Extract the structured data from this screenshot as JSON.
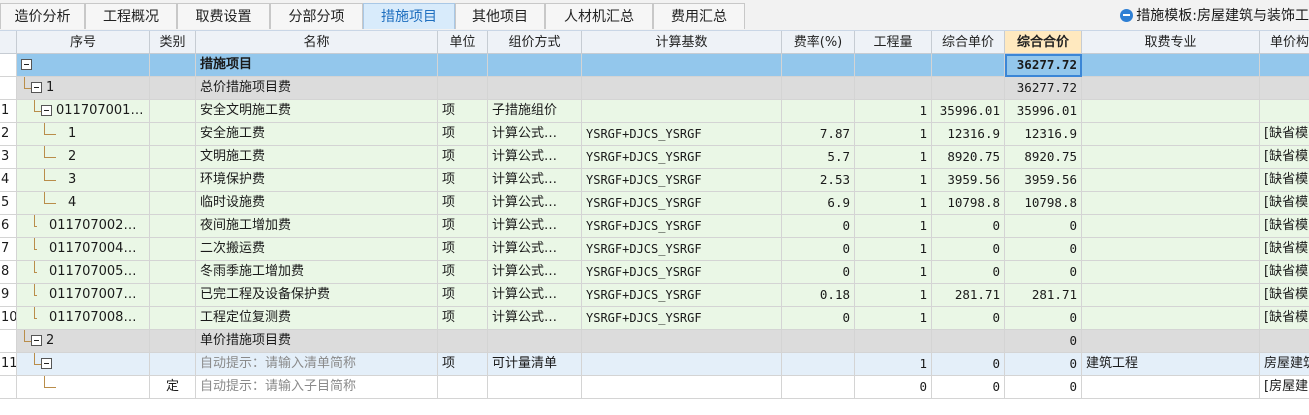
{
  "tabs": [
    {
      "label": "造价分析",
      "name": "tab-cost-analysis"
    },
    {
      "label": "工程概况",
      "name": "tab-project-overview"
    },
    {
      "label": "取费设置",
      "name": "tab-fee-settings"
    },
    {
      "label": "分部分项",
      "name": "tab-sub-items"
    },
    {
      "label": "措施项目",
      "name": "tab-measure-items",
      "active": true
    },
    {
      "label": "其他项目",
      "name": "tab-other-items"
    },
    {
      "label": "人材机汇总",
      "name": "tab-resource-summary"
    },
    {
      "label": "费用汇总",
      "name": "tab-fee-summary"
    }
  ],
  "template_label": "措施模板:房屋建筑与装饰工",
  "columns": [
    "",
    "序号",
    "类别",
    "名称",
    "单位",
    "组价方式",
    "计算基数",
    "费率(%)",
    "工程量",
    "综合单价",
    "综合合价",
    "取费专业",
    "单价构"
  ],
  "rows": [
    {
      "rownum": "",
      "level": 0,
      "seq": "",
      "type": "",
      "name": "措施项目",
      "unit": "",
      "method": "",
      "base": "",
      "rate": "",
      "qty": "",
      "price": "",
      "total": "36277.72",
      "fee": "",
      "unitc": "",
      "bg": "head",
      "bold": true,
      "toggle": true
    },
    {
      "rownum": "",
      "level": 1,
      "seq": "1",
      "type": "",
      "name": "总价措施项目费",
      "unit": "",
      "method": "",
      "base": "",
      "rate": "",
      "qty": "",
      "price": "",
      "total": "36277.72",
      "fee": "",
      "unitc": "",
      "bg": "grey",
      "toggle": true
    },
    {
      "rownum": "1",
      "level": 2,
      "seq": "011707001…",
      "type": "",
      "name": "安全文明施工费",
      "unit": "项",
      "method": "子措施组价",
      "base": "",
      "rate": "",
      "qty": "1",
      "price": "35996.01",
      "total": "35996.01",
      "fee": "",
      "unitc": "",
      "bg": "green",
      "toggle": true
    },
    {
      "rownum": "2",
      "level": 3,
      "seq": "1",
      "type": "",
      "name": "安全施工费",
      "unit": "项",
      "method": "计算公式…",
      "base": "YSRGF+DJCS_YSRGF",
      "rate": "7.87",
      "qty": "1",
      "price": "12316.9",
      "total": "12316.9",
      "fee": "",
      "unitc": "[缺省模",
      "bg": "green"
    },
    {
      "rownum": "3",
      "level": 3,
      "seq": "2",
      "type": "",
      "name": "文明施工费",
      "unit": "项",
      "method": "计算公式…",
      "base": "YSRGF+DJCS_YSRGF",
      "rate": "5.7",
      "qty": "1",
      "price": "8920.75",
      "total": "8920.75",
      "fee": "",
      "unitc": "[缺省模",
      "bg": "green"
    },
    {
      "rownum": "4",
      "level": 3,
      "seq": "3",
      "type": "",
      "name": "环境保护费",
      "unit": "项",
      "method": "计算公式…",
      "base": "YSRGF+DJCS_YSRGF",
      "rate": "2.53",
      "qty": "1",
      "price": "3959.56",
      "total": "3959.56",
      "fee": "",
      "unitc": "[缺省模",
      "bg": "green"
    },
    {
      "rownum": "5",
      "level": 3,
      "seq": "4",
      "type": "",
      "name": "临时设施费",
      "unit": "项",
      "method": "计算公式…",
      "base": "YSRGF+DJCS_YSRGF",
      "rate": "6.9",
      "qty": "1",
      "price": "10798.8",
      "total": "10798.8",
      "fee": "",
      "unitc": "[缺省模",
      "bg": "green"
    },
    {
      "rownum": "6",
      "level": 2,
      "seq": "011707002…",
      "type": "",
      "name": "夜间施工增加费",
      "unit": "项",
      "method": "计算公式…",
      "base": "YSRGF+DJCS_YSRGF",
      "rate": "0",
      "qty": "1",
      "price": "0",
      "total": "0",
      "fee": "",
      "unitc": "[缺省模",
      "bg": "green"
    },
    {
      "rownum": "7",
      "level": 2,
      "seq": "011707004…",
      "type": "",
      "name": "二次搬运费",
      "unit": "项",
      "method": "计算公式…",
      "base": "YSRGF+DJCS_YSRGF",
      "rate": "0",
      "qty": "1",
      "price": "0",
      "total": "0",
      "fee": "",
      "unitc": "[缺省模",
      "bg": "green"
    },
    {
      "rownum": "8",
      "level": 2,
      "seq": "011707005…",
      "type": "",
      "name": "冬雨季施工增加费",
      "unit": "项",
      "method": "计算公式…",
      "base": "YSRGF+DJCS_YSRGF",
      "rate": "0",
      "qty": "1",
      "price": "0",
      "total": "0",
      "fee": "",
      "unitc": "[缺省模",
      "bg": "green"
    },
    {
      "rownum": "9",
      "level": 2,
      "seq": "011707007…",
      "type": "",
      "name": "已完工程及设备保护费",
      "unit": "项",
      "method": "计算公式…",
      "base": "YSRGF+DJCS_YSRGF",
      "rate": "0.18",
      "qty": "1",
      "price": "281.71",
      "total": "281.71",
      "fee": "",
      "unitc": "[缺省模",
      "bg": "green"
    },
    {
      "rownum": "10",
      "level": 2,
      "seq": "011707008…",
      "type": "",
      "name": "工程定位复测费",
      "unit": "项",
      "method": "计算公式…",
      "base": "YSRGF+DJCS_YSRGF",
      "rate": "0",
      "qty": "1",
      "price": "0",
      "total": "0",
      "fee": "",
      "unitc": "[缺省模",
      "bg": "green"
    },
    {
      "rownum": "",
      "level": 1,
      "seq": "2",
      "type": "",
      "name": "单价措施项目费",
      "unit": "",
      "method": "",
      "base": "",
      "rate": "",
      "qty": "",
      "price": "",
      "total": "0",
      "fee": "",
      "unitc": "",
      "bg": "grey",
      "toggle": true
    },
    {
      "rownum": "11",
      "level": 2,
      "seq": "",
      "type": "",
      "name": "自动提示：请输入清单简称",
      "unit": "项",
      "method": "可计量清单",
      "base": "",
      "rate": "",
      "qty": "1",
      "price": "0",
      "total": "0",
      "fee": "建筑工程",
      "unitc": "房屋建筑",
      "bg": "blue",
      "hint": true,
      "toggle": true
    },
    {
      "rownum": "",
      "level": 3,
      "seq": "",
      "type": "定",
      "name": "自动提示：请输入子目简称",
      "unit": "",
      "method": "",
      "base": "",
      "rate": "",
      "qty": "0",
      "price": "0",
      "total": "0",
      "fee": "",
      "unitc": "[房屋建",
      "bg": "white",
      "hint": true
    }
  ]
}
